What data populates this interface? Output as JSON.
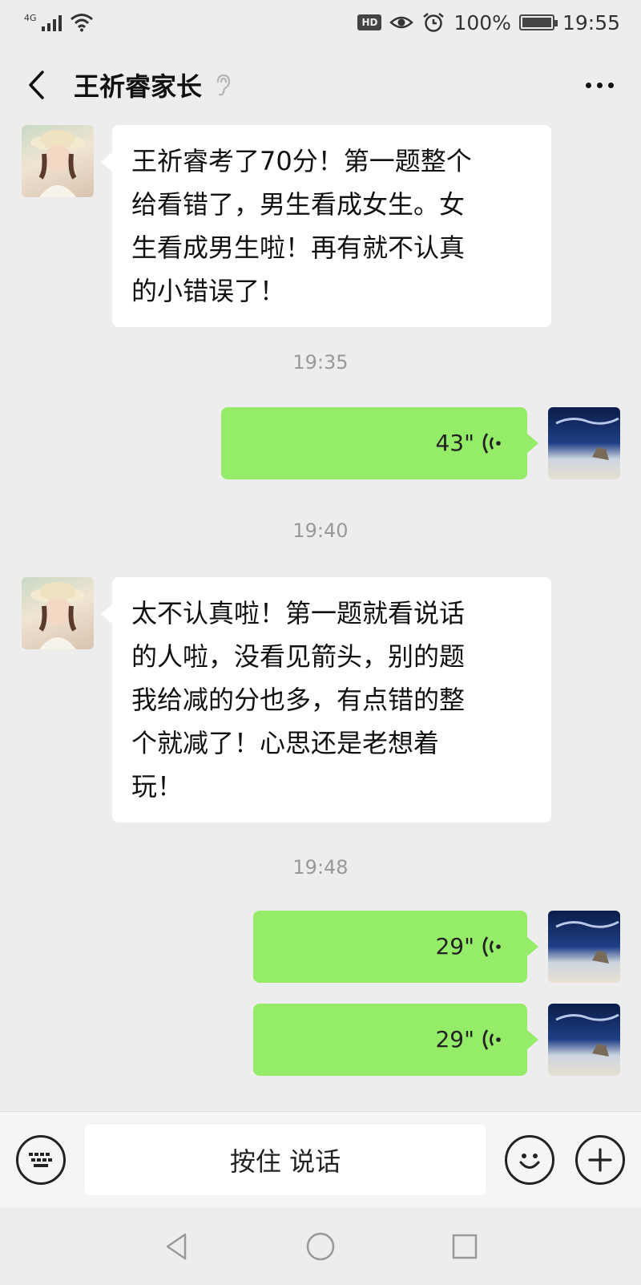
{
  "status_bar": {
    "network": "4G",
    "battery_text": "100%",
    "battery_level": 1.0,
    "time": "19:55",
    "hd_label": "HD"
  },
  "header": {
    "title": "王祈睿家长"
  },
  "messages": [
    {
      "type": "text",
      "side": "left",
      "lines": [
        "王祈睿考了70分！第一题整个",
        "给看错了，男生看成女生。女",
        "生看成男生啦！再有就不认真",
        "的小错误了！"
      ]
    },
    {
      "type": "timestamp",
      "text": "19:35"
    },
    {
      "type": "voice",
      "side": "right",
      "duration": "43\""
    },
    {
      "type": "timestamp",
      "text": "19:40"
    },
    {
      "type": "text",
      "side": "left",
      "lines": [
        "太不认真啦！第一题就看说话",
        "的人啦，没看见箭头，别的题",
        "我给减的分也多，有点错的整",
        "个就减了！心思还是老想着",
        "玩！"
      ]
    },
    {
      "type": "timestamp",
      "text": "19:48"
    },
    {
      "type": "voice",
      "side": "right",
      "duration": "29\""
    },
    {
      "type": "voice",
      "side": "right",
      "duration": "29\""
    }
  ],
  "input_bar": {
    "hold_to_talk_label": "按住 说话"
  },
  "colors": {
    "background": "#ededed",
    "voice_bubble": "#95ec69",
    "text_bubble": "#ffffff",
    "timestamp": "#999999"
  },
  "icons": [
    "signal-icon",
    "wifi-icon",
    "eye-icon",
    "alarm-icon",
    "battery-icon",
    "back-arrow-icon",
    "ear-icon",
    "more-icon",
    "voice-wave-icon",
    "keyboard-icon",
    "emoji-icon",
    "plus-icon",
    "nav-back-icon",
    "nav-home-icon",
    "nav-recents-icon"
  ]
}
